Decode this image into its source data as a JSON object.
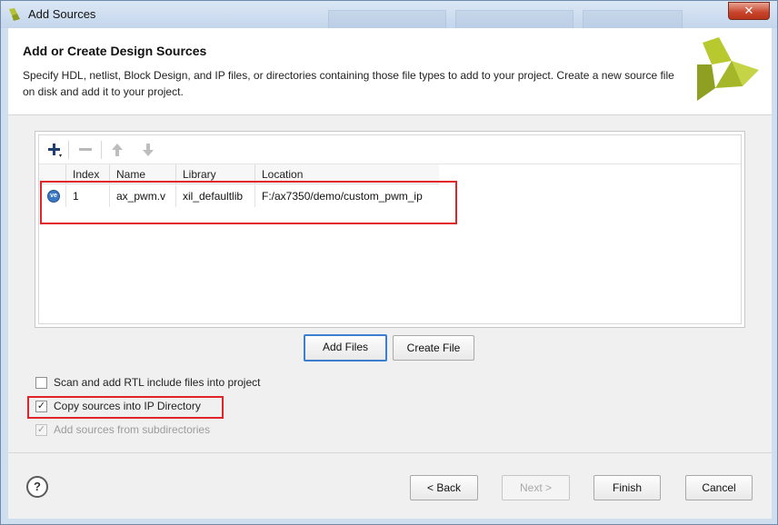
{
  "window": {
    "title": "Add Sources",
    "close_glyph": "✕"
  },
  "header": {
    "heading": "Add or Create Design Sources",
    "description": "Specify HDL, netlist, Block Design, and IP files, or directories containing those file types to add to your project. Create a new source file on disk and add it to your project."
  },
  "toolbar": {
    "icons": [
      "add-icon",
      "remove-icon",
      "move-up-icon",
      "move-down-icon"
    ]
  },
  "table": {
    "columns": [
      "Index",
      "Name",
      "Library",
      "Location"
    ],
    "rows": [
      {
        "icon": "verilog-file-icon",
        "icon_text": "ve",
        "index": "1",
        "name": "ax_pwm.v",
        "library": "xil_defaultlib",
        "location": "F:/ax7350/demo/custom_pwm_ip"
      }
    ]
  },
  "buttons": {
    "add_files": "Add Files",
    "create_file": "Create File",
    "back": "< Back",
    "next": "Next >",
    "finish": "Finish",
    "cancel": "Cancel",
    "help": "?"
  },
  "options": [
    {
      "label": "Scan and add RTL include files into project",
      "checked": false,
      "enabled": true
    },
    {
      "label": "Copy sources into IP Directory",
      "checked": true,
      "enabled": true
    },
    {
      "label": "Add sources from subdirectories",
      "checked": true,
      "enabled": false
    }
  ],
  "colors": {
    "highlight_box": "#e0242a",
    "primary_border": "#3c7fd0",
    "logo_green": "#9aae2a"
  }
}
